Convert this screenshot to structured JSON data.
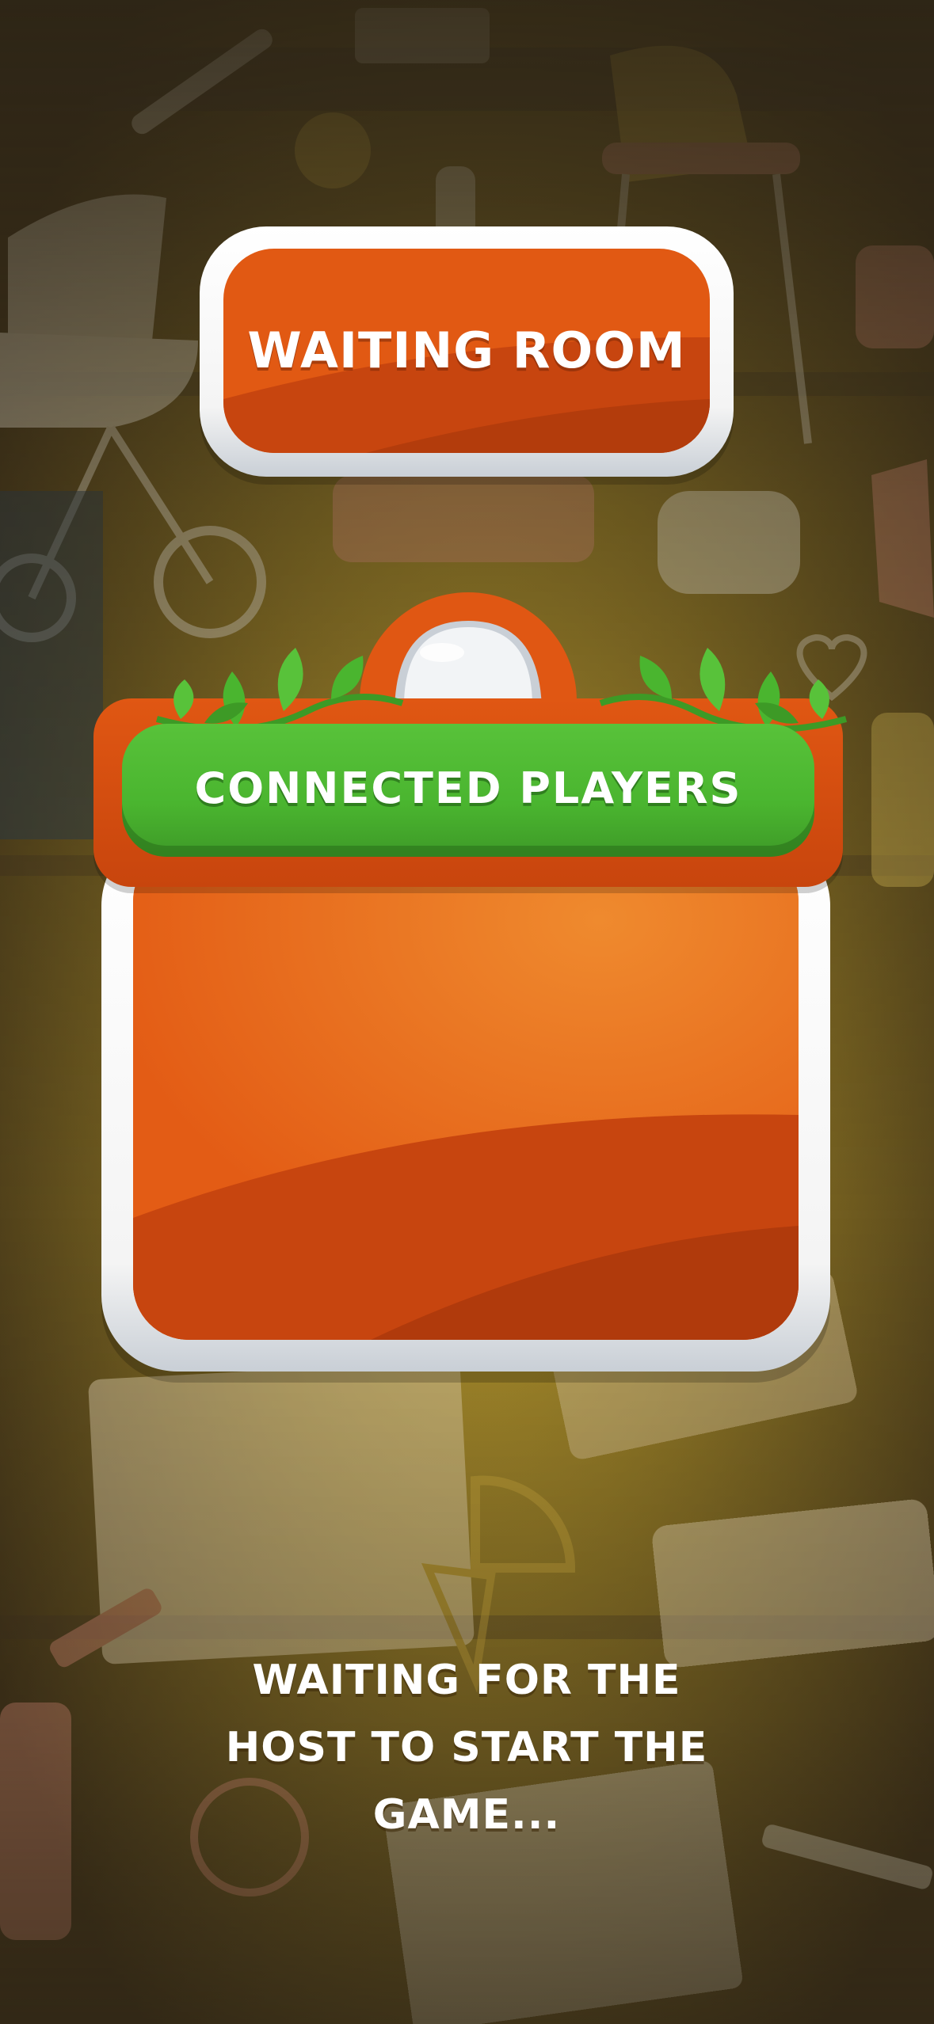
{
  "screen": {
    "title": "Waiting Room",
    "players_header": "Connected Players",
    "players": [],
    "status_message": "Waiting for the host to start the game..."
  },
  "icons": {
    "background": "nursery-room-illustration",
    "vine_left": "vine-leaves-icon",
    "vine_right": "vine-leaves-icon",
    "knob": "dome-knob-icon"
  },
  "colors": {
    "accent_orange": "#e15913",
    "accent_green": "#4ab52f",
    "frame_white": "#f4f4f4",
    "background_overlay": "#5a4a1c"
  }
}
